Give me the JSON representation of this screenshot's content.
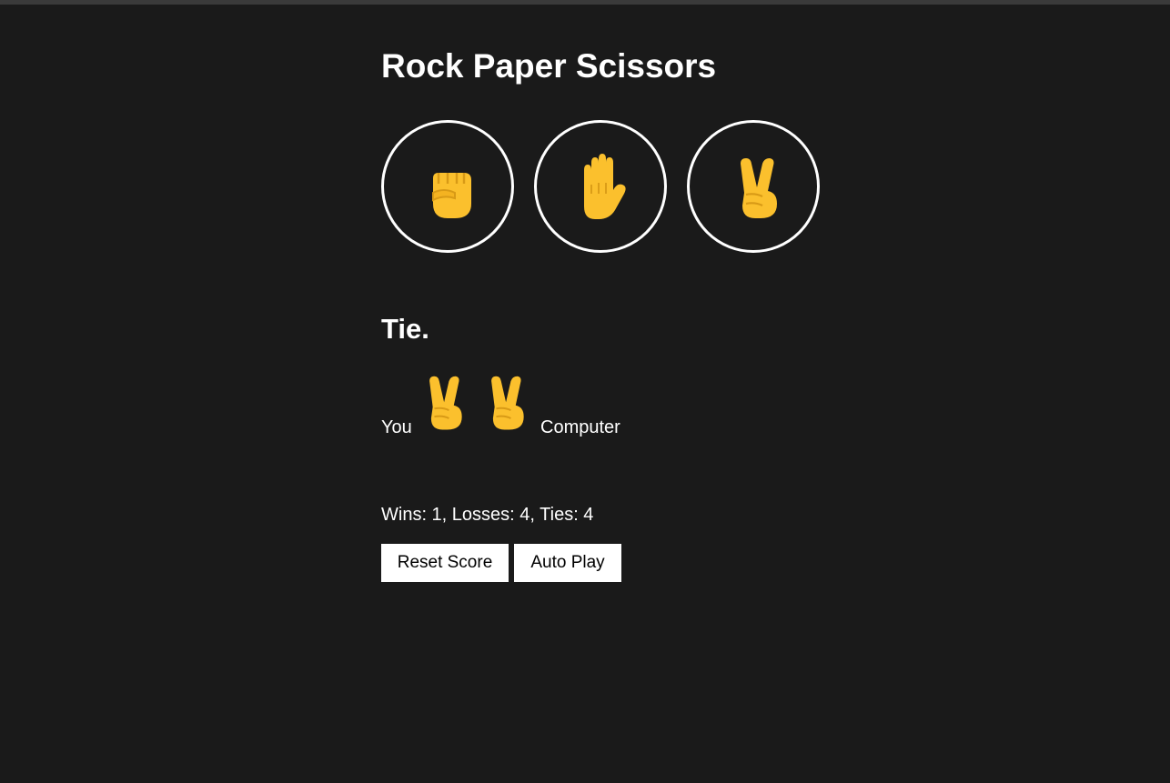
{
  "page": {
    "title": "Rock Paper Scissors"
  },
  "moves": [
    {
      "name": "rock",
      "icon": "raised-fist-icon"
    },
    {
      "name": "paper",
      "icon": "raised-hand-icon"
    },
    {
      "name": "scissors",
      "icon": "victory-hand-icon"
    }
  ],
  "result": {
    "text": "Tie.",
    "you_label": "You",
    "computer_label": "Computer",
    "player_move_icon": "victory-hand-icon",
    "computer_move_icon": "victory-hand-icon"
  },
  "score": {
    "text": "Wins: 1, Losses: 4, Ties: 4",
    "wins": 1,
    "losses": 4,
    "ties": 4
  },
  "buttons": {
    "reset_label": "Reset Score",
    "auto_play_label": "Auto Play"
  },
  "colors": {
    "background": "#1a1a1a",
    "text": "#ffffff",
    "emoji": "#fbc02d",
    "button_bg": "#ffffff"
  }
}
